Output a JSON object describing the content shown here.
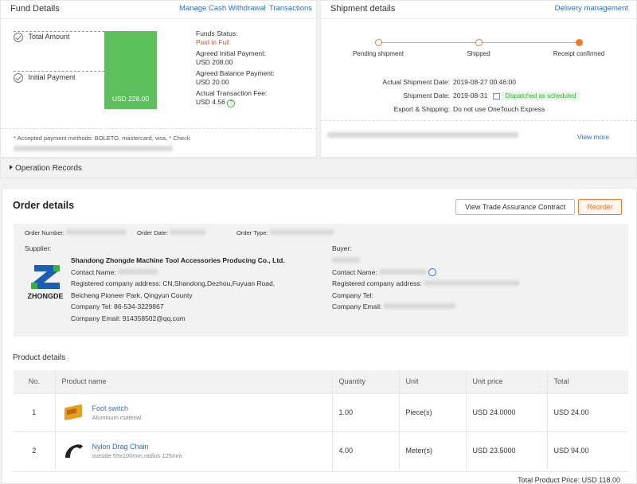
{
  "fund": {
    "title": "Fund Details",
    "manage_link": "Manage Cash Withdrawal",
    "transactions_link": "Transactions",
    "total_amount_label": "Total Amount",
    "initial_payment_label": "Initial Payment",
    "bar_value": "USD 228.00",
    "funds_status_label": "Funds Status:",
    "funds_status_value": "Paid in Full",
    "initial_payment_info_label": "Agreed Initial Payment:",
    "initial_payment_info_value": "USD 208.00",
    "balance_payment_label": "Agreed Balance Payment:",
    "balance_payment_value": "USD 20.00",
    "transaction_fee_label": "Actual Transaction Fee:",
    "transaction_fee_value": "USD 4.56",
    "accepted_methods_note": "* Accepted payment methods: BOLETO, mastercard, visa, * Check"
  },
  "shipment": {
    "title": "Shipment details",
    "delivery_link": "Delivery management",
    "steps": [
      "Pending shipment",
      "Shipped",
      "Receipt confirmed"
    ],
    "actual_date_label": "Actual Shipment Date:",
    "actual_date_value": "2019-08-27 00:46:00",
    "shipment_date_label": "Shipment Date:",
    "shipment_date_value": "2019-08-31",
    "dispatched_badge": "Dispatched as scheduled",
    "export_label": "Export & Shipping:",
    "export_value": "Do not use OneTouch Express",
    "view_more": "View more",
    "colors": {
      "active": "#f07a2f"
    }
  },
  "operation_records": "Operation Records",
  "order": {
    "title": "Order details",
    "contract_button": "View Trade Assurance Contract",
    "reorder_button": "Reorder",
    "order_number_label": "Order Number:",
    "order_date_label": "Order Date:",
    "order_type_label": "Order Type:",
    "supplier_label": "Supplier:",
    "supplier_name": "Shandong Zhongde Machine Tool Accessories Producing Co., Ltd.",
    "contact_name_label": "Contact Name:",
    "address_line1": "Registered company address: CN,Shandong,Dezhou,Fuyuan Road,",
    "address_line2": "Beicheng Pioneer Park, Qingyun County",
    "company_tel": "Company Tel: 86-534-3229867",
    "company_email": "Company Email: 914358502@qq.com",
    "logo_text": "ZHONGDE",
    "buyer_label": "Buyer:",
    "buyer_contact_label": "Contact Name:",
    "buyer_address_label": "Registered company address:",
    "buyer_tel_label": "Company Tel:",
    "buyer_email_label": "Company Email:"
  },
  "products": {
    "title": "Product details",
    "headers": [
      "No.",
      "Product name",
      "Quantity",
      "Unit",
      "Unit price",
      "Total"
    ],
    "rows": [
      {
        "no": "1",
        "name": "Foot switch",
        "desc": "Aluminum material",
        "qty": "1.00",
        "unit": "Piece(s)",
        "price": "USD 24.0000",
        "total": "USD 24.00"
      },
      {
        "no": "2",
        "name": "Nylon Drag Chain",
        "desc": "outside 55x100mm,radius 125mm",
        "qty": "4.00",
        "unit": "Meter(s)",
        "price": "USD 23.5000",
        "total": "USD 94.00"
      }
    ],
    "total_label": "Total Product Price:",
    "total_value": "USD 118.00"
  }
}
